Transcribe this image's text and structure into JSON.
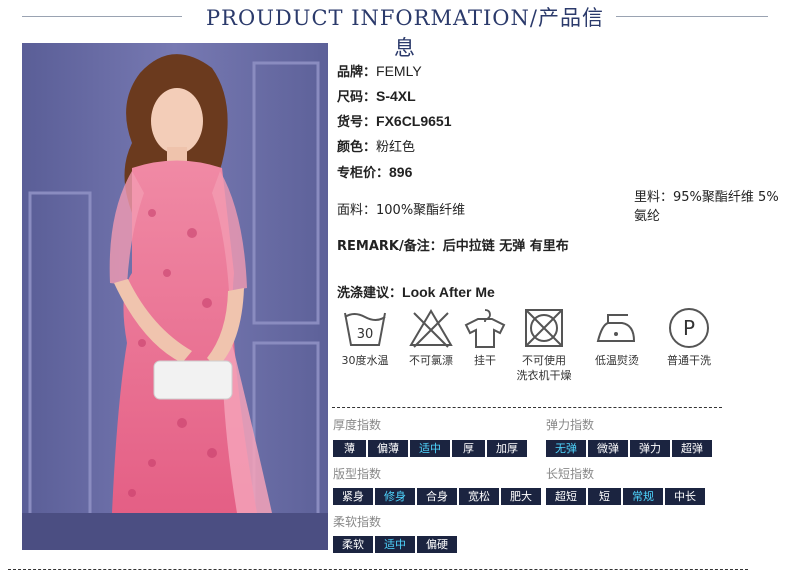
{
  "header": {
    "title": "PROUDUCT INFORMATION/产品信息"
  },
  "product": {
    "brand_label": "品牌：",
    "brand": "FEMLY",
    "size_label": "尺码：",
    "size": "S-4XL",
    "sku_label": "货号：",
    "sku": "FX6CL9651",
    "color_label": "颜色：",
    "color": "粉红色",
    "price_label": "专柜价：",
    "price": "896",
    "fabric_label": "面料：",
    "fabric": "100%聚酯纤维",
    "lining_label": "里料：",
    "lining": "95%聚酯纤维 5%氨纶",
    "remark_label": "REMARK/备注：",
    "remark": "后中拉链 无弹 有里布",
    "wash_label": "洗涤建议：",
    "wash": "Look After Me"
  },
  "care": [
    {
      "icon": "wash-30-icon",
      "label": "30度水温",
      "label2": "",
      "num": "30"
    },
    {
      "icon": "no-bleach-icon",
      "label": "不可氯漂",
      "label2": ""
    },
    {
      "icon": "hang-dry-icon",
      "label": "挂干",
      "label2": ""
    },
    {
      "icon": "no-tumble-dry-icon",
      "label": "不可使用",
      "label2": "洗衣机干燥"
    },
    {
      "icon": "low-iron-icon",
      "label": "低温熨烫",
      "label2": ""
    },
    {
      "icon": "dry-clean-icon",
      "label": "普通干洗",
      "label2": "",
      "letter": "P"
    }
  ],
  "indices": {
    "thickness": {
      "title": "厚度指数",
      "options": [
        "薄",
        "偏薄",
        "适中",
        "厚",
        "加厚"
      ],
      "selected": 2
    },
    "elasticity": {
      "title": "弹力指数",
      "options": [
        "无弹",
        "微弹",
        "弹力",
        "超弹"
      ],
      "selected": 0
    },
    "fit": {
      "title": "版型指数",
      "options": [
        "紧身",
        "修身",
        "合身",
        "宽松",
        "肥大"
      ],
      "selected": 1
    },
    "length": {
      "title": "长短指数",
      "options": [
        "超短",
        "短",
        "常规",
        "中长"
      ],
      "selected": 2
    },
    "softness": {
      "title": "柔软指数",
      "options": [
        "柔软",
        "适中",
        "偏硬"
      ],
      "selected": 1
    }
  },
  "colors": {
    "chip_bg": "#1b2440",
    "chip_selected_text": "#4fd6ff",
    "title_color": "#2b3a6b",
    "dress_pink": "#e8708f"
  }
}
